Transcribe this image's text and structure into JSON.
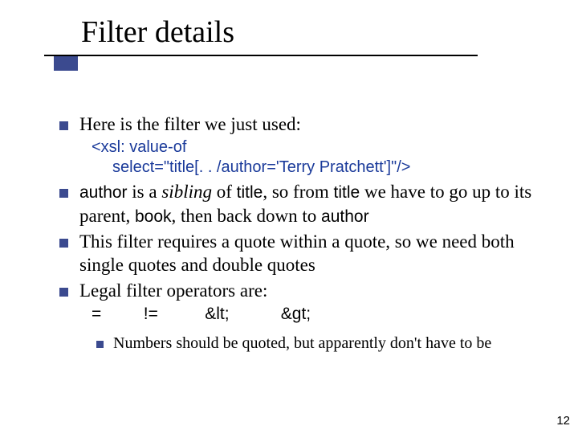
{
  "title": "Filter details",
  "bullets": {
    "b0": "Here is the filter we just used:",
    "code": {
      "line1": "<xsl: value-of",
      "line2": "select=\"title[. . /author='Terry Pratchett']\"/>"
    },
    "b1": {
      "pre": "",
      "author": "author",
      "mid1": " is a ",
      "sibling": "sibling",
      "mid2": " of ",
      "title1": "title",
      "mid3": ", so from ",
      "title2": "title",
      "mid4": " we have to go up to its parent, ",
      "book": "book",
      "mid5": ", then back down to ",
      "author2": "author"
    },
    "b2": "This filter requires a quote within a quote, so we need both single quotes and double quotes",
    "b3": "Legal filter operators are:",
    "ops": {
      "eq": "=",
      "neq": "!=",
      "lt": "&lt;",
      "gt": "&gt;"
    },
    "sub": "Numbers should be quoted, but apparently don't have to be"
  },
  "pageNumber": "12"
}
